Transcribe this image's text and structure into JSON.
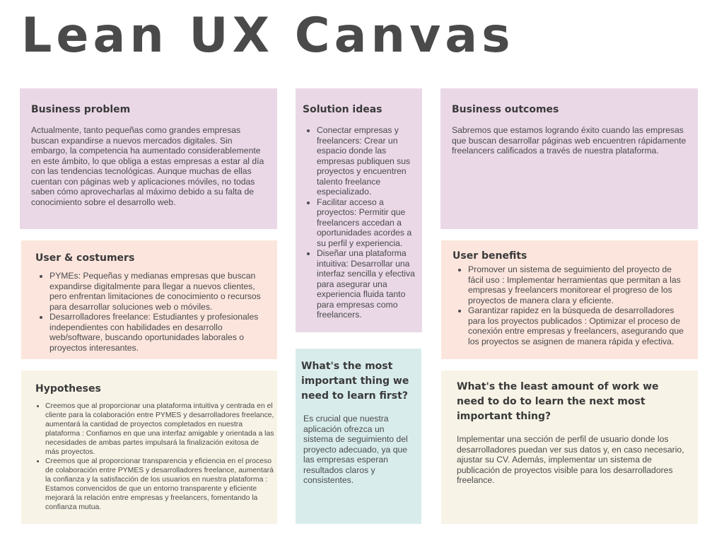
{
  "title": "Lean UX Canvas",
  "business_problem": {
    "heading": "Business problem",
    "text": "Actualmente, tanto pequeñas como grandes empresas buscan expandirse a nuevos mercados digitales. Sin embargo, la competencia ha aumentado considerablemente en este ámbito, lo que obliga a estas empresas a estar al día con las tendencias tecnológicas. Aunque muchas de ellas cuentan con páginas web y aplicaciones móviles, no todas saben cómo aprovecharlas al máximo debido a su falta de conocimiento sobre el desarrollo web."
  },
  "solution_ideas": {
    "heading": "Solution ideas",
    "items": [
      "Conectar empresas y freelancers: Crear un espacio donde las empresas publiquen sus proyectos y encuentren talento freelance especializado.",
      "Facilitar acceso a proyectos: Permitir que freelancers accedan a oportunidades acordes a su perfil y experiencia.",
      "Diseñar una plataforma intuitiva: Desarrollar una interfaz sencilla y efectiva para asegurar una experiencia fluida tanto para empresas como freelancers."
    ]
  },
  "business_outcomes": {
    "heading": "Business outcomes",
    "text": "Sabremos que estamos logrando éxito cuando las empresas que buscan desarrollar páginas web encuentren rápidamente freelancers calificados a través de nuestra plataforma."
  },
  "user_costumers": {
    "heading": "User & costumers",
    "items": [
      "PYMEs: Pequeñas y medianas empresas que buscan expandirse digitalmente para llegar a nuevos clientes, pero enfrentan limitaciones de conocimiento o recursos para desarrollar soluciones web o móviles.",
      "Desarrolladores freelance: Estudiantes y profesionales independientes con habilidades en desarrollo web/software, buscando oportunidades laborales o proyectos interesantes."
    ]
  },
  "user_benefits": {
    "heading": "User benefits",
    "items": [
      "Promover un sistema de seguimiento del proyecto de fácil uso : Implementar herramientas que permitan a las empresas y freelancers monitorear el progreso de los proyectos de manera clara y eficiente.",
      "Garantizar rapidez en la búsqueda de desarrolladores para los proyectos publicados : Optimizar el proceso de conexión entre empresas y freelancers, asegurando que los proyectos se asignen de manera rápida y efectiva."
    ]
  },
  "hypotheses": {
    "heading": "Hypotheses",
    "items": [
      "Creemos que al proporcionar una plataforma intuitiva y centrada en el cliente para la colaboración entre PYMES y desarrolladores freelance, aumentará la cantidad de proyectos completados en nuestra plataforma : Confiamos en que una interfaz amigable y orientada a las necesidades de ambas partes impulsará la finalización exitosa de más proyectos.",
      "Creemos que al proporcionar transparencia y eficiencia en el proceso de colaboración entre PYMES y desarrolladores freelance, aumentará la confianza y la satisfacción de los usuarios en nuestra plataforma : Estamos convencidos de que un entorno transparente y eficiente mejorará la relación entre empresas y freelancers, fomentando la confianza mutua."
    ]
  },
  "most_important": {
    "heading": "What's the most important thing we need to learn first?",
    "text": "Es crucial que nuestra aplicación ofrezca un sistema de seguimiento del proyecto adecuado, ya que las empresas esperan resultados claros y consistentes."
  },
  "least_work": {
    "heading": "What's the least amount of work we need to do to learn the next most important thing?",
    "text": "Implementar una sección de perfil de usuario donde los desarrolladores puedan ver sus datos y, en caso necesario, ajustar su CV. Además, implementar un sistema de publicación de proyectos visible para los desarrolladores freelance."
  }
}
